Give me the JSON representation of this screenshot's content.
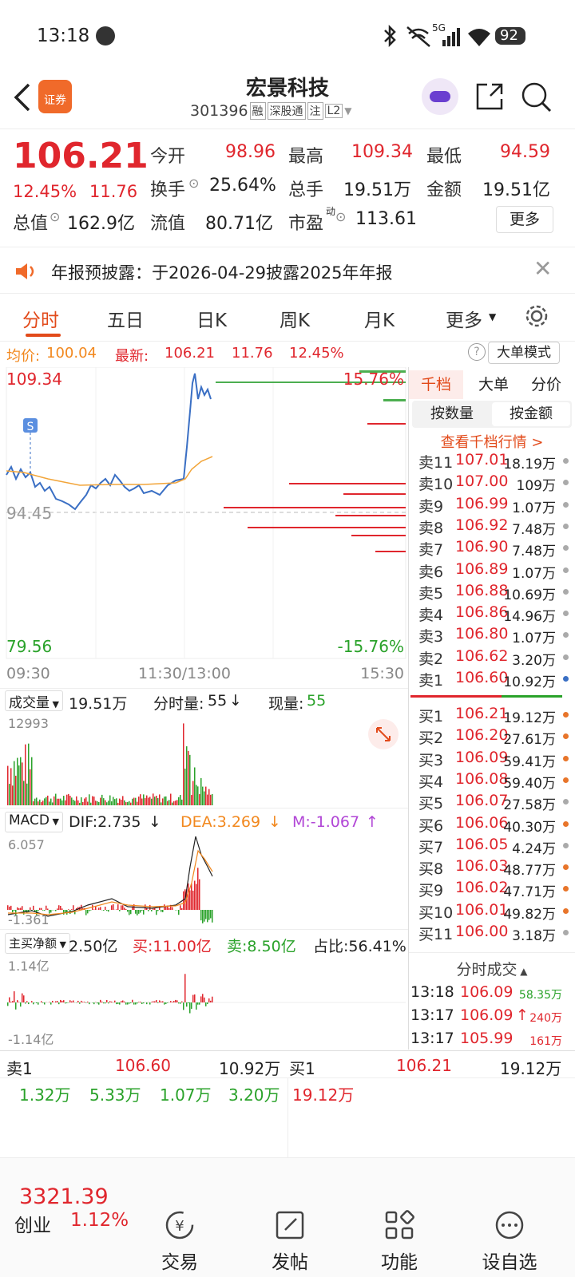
{
  "status": {
    "time": "13:18",
    "network": "5G",
    "battery": "92"
  },
  "header": {
    "title": "宏景科技",
    "code": "301396",
    "badges": [
      "融",
      "深股通",
      "注",
      "L2"
    ],
    "broker_badge": "证券"
  },
  "quote": {
    "price": "106.21",
    "change_pct": "12.45%",
    "change": "11.76",
    "open_label": "今开",
    "open": "98.96",
    "high_label": "最高",
    "high": "109.34",
    "low_label": "最低",
    "low": "94.59",
    "turnover_label": "换手",
    "turnover": "25.64%",
    "volume_label": "总手",
    "volume": "19.51万",
    "amount_label": "金额",
    "amount": "19.51亿",
    "mcap_label": "总值",
    "mcap": "162.9亿",
    "float_label": "流值",
    "float": "80.71亿",
    "pe_label": "市盈",
    "pe_sup": "动",
    "pe": "113.61",
    "more_label": "更多"
  },
  "notice": {
    "text": "年报预披露：于2026-04-29披露2025年年报"
  },
  "tabs": [
    "分时",
    "五日",
    "日K",
    "周K",
    "月K",
    "更多"
  ],
  "intraday": {
    "avg_label": "均价:",
    "avg": "100.04",
    "last_label": "最新:",
    "last": "106.21",
    "change": "11.76",
    "change_pct": "12.45%",
    "big_order_label": "大单模式",
    "y_top": "109.34",
    "y_mid": "94.45",
    "y_bottom": "79.56",
    "pct_top": "15.76%",
    "pct_bottom": "-15.76%",
    "x_start": "09:30",
    "x_mid": "11:30/13:00",
    "x_end": "15:30",
    "s_marker": "S"
  },
  "volume_panel": {
    "selector": "成交量",
    "total": "19.51万",
    "min_label": "分时量:",
    "min_value": "55",
    "arrow": "↓",
    "now_label": "现量:",
    "now_value": "55",
    "max": "12993"
  },
  "macd_panel": {
    "selector": "MACD",
    "dif": "DIF:2.735",
    "dif_arrow": "↓",
    "dea": "DEA:3.269",
    "dea_arrow": "↓",
    "m": "M:-1.067",
    "m_arrow": "↑",
    "top": "6.057",
    "bottom": "-1.361"
  },
  "netflow_panel": {
    "label": "主买净额",
    "net": "2.50亿",
    "buy": "买:11.00亿",
    "sell": "卖:8.50亿",
    "ratio": "占比:56.41%",
    "top": "1.14亿",
    "bottom": "-1.14亿"
  },
  "book": {
    "tabs": [
      "千档",
      "大单",
      "分价"
    ],
    "subtabs": [
      "按数量",
      "按金额"
    ],
    "link": "查看千档行情 >",
    "asks": [
      {
        "side": "卖11",
        "price": "107.01",
        "vol": "18.19万"
      },
      {
        "side": "卖10",
        "price": "107.00",
        "vol": "109万"
      },
      {
        "side": "卖9",
        "price": "106.99",
        "vol": "1.07万"
      },
      {
        "side": "卖8",
        "price": "106.92",
        "vol": "7.48万"
      },
      {
        "side": "卖7",
        "price": "106.90",
        "vol": "7.48万"
      },
      {
        "side": "卖6",
        "price": "106.89",
        "vol": "1.07万"
      },
      {
        "side": "卖5",
        "price": "106.88",
        "vol": "10.69万"
      },
      {
        "side": "卖4",
        "price": "106.86",
        "vol": "14.96万"
      },
      {
        "side": "卖3",
        "price": "106.80",
        "vol": "1.07万"
      },
      {
        "side": "卖2",
        "price": "106.62",
        "vol": "3.20万"
      },
      {
        "side": "卖1",
        "price": "106.60",
        "vol": "10.92万"
      }
    ],
    "bids": [
      {
        "side": "买1",
        "price": "106.21",
        "vol": "19.12万"
      },
      {
        "side": "买2",
        "price": "106.20",
        "vol": "27.61万"
      },
      {
        "side": "买3",
        "price": "106.09",
        "vol": "59.41万"
      },
      {
        "side": "买4",
        "price": "106.08",
        "vol": "59.40万"
      },
      {
        "side": "买5",
        "price": "106.07",
        "vol": "27.58万"
      },
      {
        "side": "买6",
        "price": "106.06",
        "vol": "40.30万"
      },
      {
        "side": "买7",
        "price": "106.05",
        "vol": "4.24万"
      },
      {
        "side": "买8",
        "price": "106.03",
        "vol": "48.77万"
      },
      {
        "side": "买9",
        "price": "106.02",
        "vol": "47.71万"
      },
      {
        "side": "买10",
        "price": "106.01",
        "vol": "49.82万"
      },
      {
        "side": "买11",
        "price": "106.00",
        "vol": "3.18万"
      }
    ],
    "trades_title": "分时成交",
    "trades": [
      {
        "time": "13:18",
        "price": "106.09",
        "vol": "58.35万"
      },
      {
        "time": "13:17",
        "price": "106.09",
        "vol": "240万",
        "arrow": "↑"
      },
      {
        "time": "13:17",
        "price": "105.99",
        "vol": "161万"
      }
    ]
  },
  "level1": {
    "sell_label": "卖1",
    "sell_price": "106.60",
    "sell_vol": "10.92万",
    "buy_label": "买1",
    "buy_price": "106.21",
    "buy_vol": "19.12万",
    "sell_queue": [
      "1.32万",
      "5.33万",
      "1.07万",
      "3.20万"
    ],
    "buy_queue": [
      "19.12万"
    ]
  },
  "bottom_nav": {
    "index_value": "3321.39",
    "index_name": "创业",
    "index_pct": "1.12%",
    "items": [
      "交易",
      "发帖",
      "功能",
      "设自选"
    ]
  }
}
